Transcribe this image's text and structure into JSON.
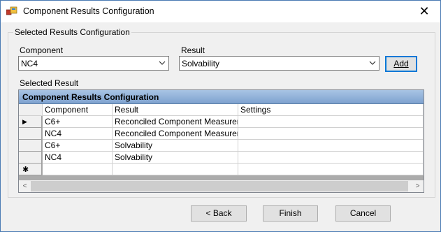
{
  "window": {
    "title": "Component Results Configuration",
    "close_glyph": "✕"
  },
  "group": {
    "title": "Selected Results Configuration"
  },
  "component": {
    "label": "Component",
    "value": "NC4"
  },
  "result": {
    "label": "Result",
    "value": "Solvability"
  },
  "buttons": {
    "add": "Add",
    "back": "< Back",
    "finish": "Finish",
    "cancel": "Cancel"
  },
  "selected_result_label": "Selected Result",
  "grid": {
    "caption": "Component Results Configuration",
    "columns": [
      "Component",
      "Result",
      "Settings"
    ],
    "current_row_marker": "▶",
    "new_row_marker": "✱",
    "rows": [
      {
        "component": "C6+",
        "result": "Reconciled Component Measurem",
        "settings": ""
      },
      {
        "component": "NC4",
        "result": "Reconciled Component Measurem",
        "settings": ""
      },
      {
        "component": "C6+",
        "result": "Solvability",
        "settings": ""
      },
      {
        "component": "NC4",
        "result": "Solvability",
        "settings": ""
      }
    ],
    "scroll_left": "<",
    "scroll_right": ">"
  },
  "colors": {
    "accent": "#0078d7",
    "caption_bg": "#7ea2cf",
    "grid_bg": "#ababab"
  }
}
